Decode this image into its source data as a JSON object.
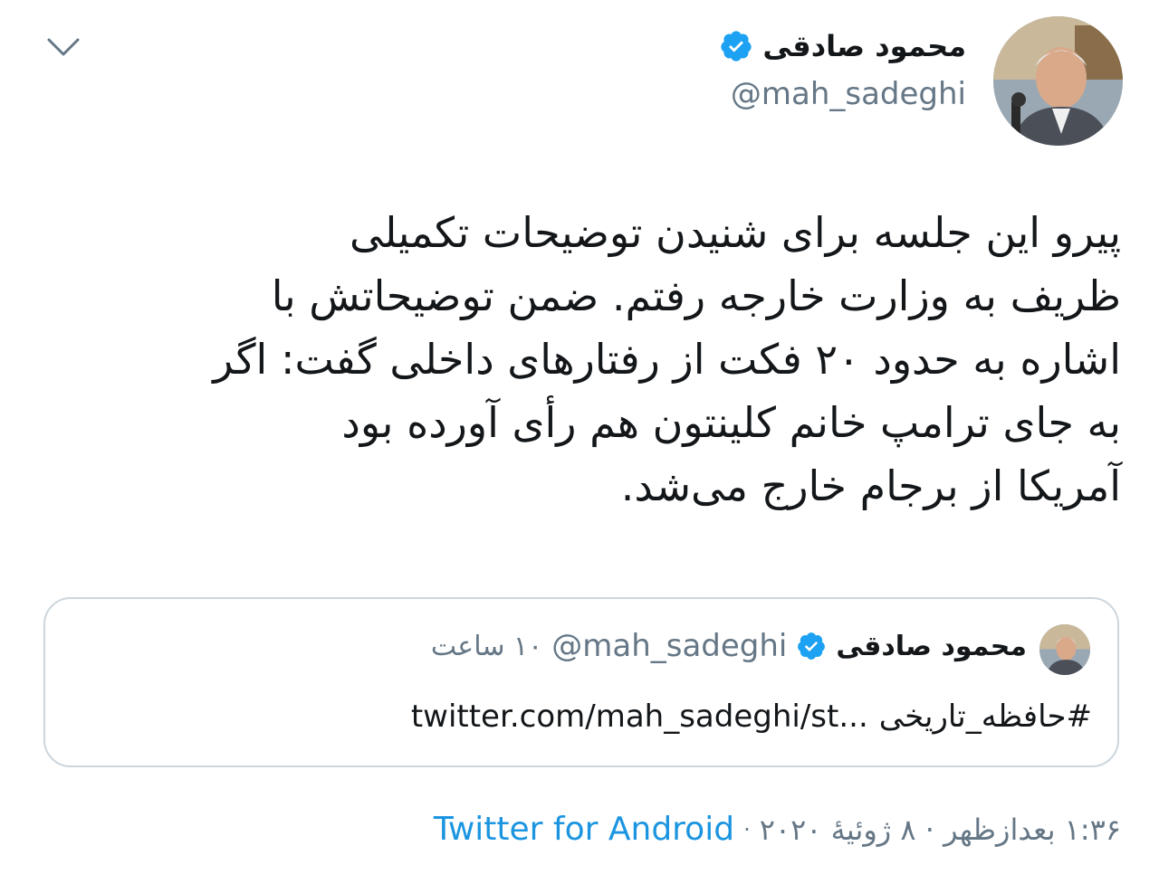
{
  "header": {
    "display_name": "محمود صادقی",
    "handle": "@mah_sadeghi",
    "verified_icon": "verified-badge-icon",
    "collapse_icon": "chevron-down-icon"
  },
  "tweet": {
    "lines": [
      "پیرو این جلسه برای شنیدن توضیحات تکمیلی",
      "ظریف به وزارت خارجه رفتم. ضمن توضیحاتش با",
      "اشاره به حدود ۲۰ فکت از رفتارهای داخلی گفت: اگر",
      "به جای ترامپ خانم کلینتون هم رأی آورده بود",
      "آمریکا از برجام خارج می‌شد."
    ]
  },
  "quote": {
    "display_name": "محمود صادقی",
    "handle": "@mah_sadeghi",
    "time": "۱۰ ساعت",
    "hashtag": "#حافظه_تاریخی",
    "link": "twitter.com/mah_sadeghi/st..."
  },
  "footer": {
    "timestamp": "۱:۳۶ بعدازظهر · ۸ ژوئیهٔ ۲۰۲۰",
    "separator": "·",
    "source": "Twitter for Android"
  },
  "colors": {
    "verified_blue": "#1da1f2",
    "link_blue": "#1b95e0",
    "secondary_text": "#657786",
    "border": "#ccd6dd"
  }
}
